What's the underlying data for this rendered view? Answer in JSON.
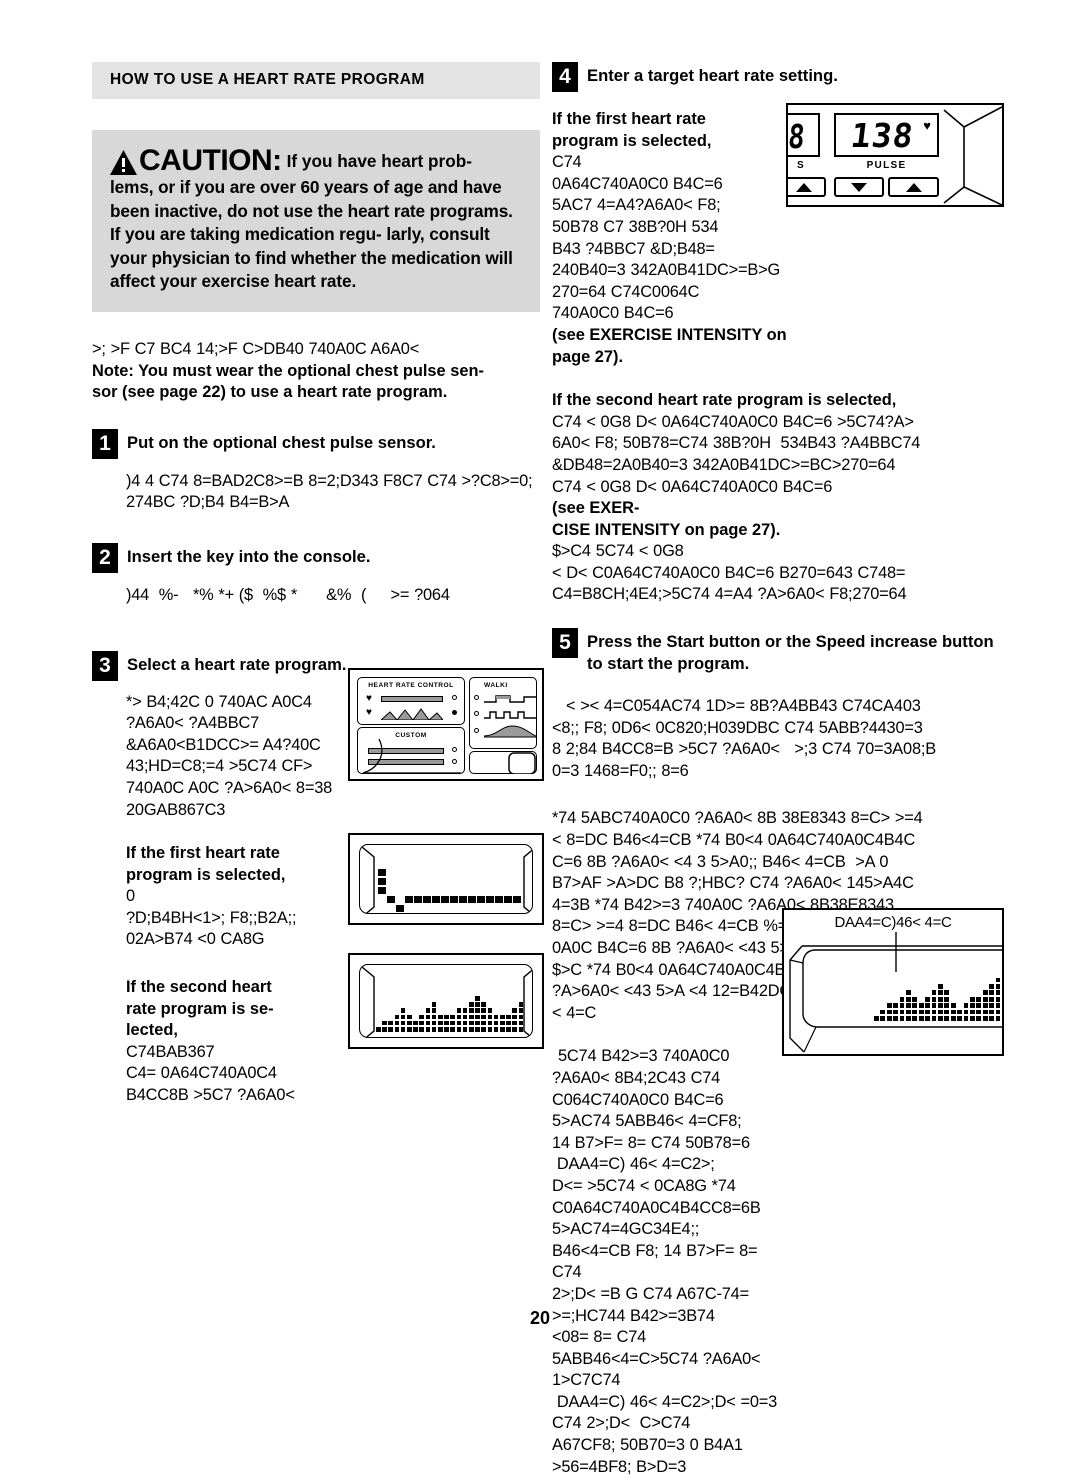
{
  "document": {
    "page_number": "20"
  },
  "left_column": {
    "section_title": "HOW TO USE A HEART RATE PROGRAM",
    "caution": {
      "warning_icon": "warning-triangle-icon",
      "heading": "CAUTION:",
      "lead_in": "If you have heart prob-",
      "body": "lems, or if you are over 60 years of age and\nhave been inactive, do not use the heart rate\nprograms. If you are taking medication regu-\nlarly, consult your physician to find whether the\nmedication will affect your exercise heart rate."
    },
    "intro_garbled": ">; >F C7 BC4 14;>F C>DB40 740A0C A6A0<",
    "intro_note": "Note: You must wear the optional chest pulse sen-\nsor (see page 22) to use a heart rate program.",
    "steps": [
      {
        "number": "1",
        "heading": "Put on the optional chest pulse sensor.",
        "body_garbled": ")4 4 C74 8=BAD2C8>=B 8=2;D343 F8C7 C74 >?C8>=0;\n274BC ?D;B4 B4=B>A"
      },
      {
        "number": "2",
        "heading": "Insert the key into the console.",
        "body_garbled": ")44  %-   *% *+ ($  %$ *      &%  (     >= ?064"
      },
      {
        "number": "3",
        "heading": "Select a heart rate program.",
        "body_garbled": "*> B4;42C 0 740AC A0C4\n?A6A0< ?A4BBC7\n&A6A0<B1DCC>= A4?40C\n43;HD=C8;=4 >5C74 CF>\n740A0C A0C ?A>6A0< 8=38\n20GAB867C3",
        "first_program": {
          "bold": "If the first heart rate\nprogram is selected,",
          "garbled": "0\n?D;B4BH<1>; F8;;B2A;;\n02A>B74 <0 CA8G"
        },
        "second_program": {
          "bold": "If the second heart\nrate program is se-\nlected,",
          "garbled": "C74BAB367\nC4= 0A64C740A0C4\nB4CC8B >5C7 ?A6A0<"
        }
      }
    ],
    "console_panel": {
      "heart_rate_control_label": "HEART RATE CONTROL",
      "custom_label": "CUSTOM",
      "walk_label": "WALKI",
      "heart_icon": "heart-icon"
    }
  },
  "right_column": {
    "steps": [
      {
        "number": "4",
        "heading": "Enter a target heart rate setting.",
        "first_program": {
          "bold": "If the first heart rate\nprogram is selected,",
          "garbled": "C74\n0A64C740A0C0 B4C=6\n5AC7 4=A4?A6A0< F8;\n50B78 C7 38B?0H 534\nB43 ?4BBC7 &D;B48=\n240B40=3 342A0B41DC>=B>G 270=64 C74C0064C\n740A0C0 B4C=6",
          "see_ref": "(see EXERCISE INTENSITY on\npage 27)."
        },
        "second_program": {
          "bold": "If the second heart rate program is selected,",
          "garbled": "C74 < 0G8 D< 0A64C740A0C0 B4C=6 >5C74?A>\n6A0< F8; 50B78=C74 38B?0H  534B43 ?A4BBC74\n&DB48=2A0B40=3 342A0B41DC>=BC>270=64\nC74 < 0G8 D< 0A64C740A0C0 B4C=6",
          "see_ref2": "(see EXER-\nCISE INTENSITY on page 27).",
          "garbled2": "$>C4 5C74 < 0G8\n< D< C0A64C740A0C0 B4C=6 B270=643 C748=\nC4=B8CH;4E4;>5C74 4=A4 ?A>6A0< F8;270=64"
        }
      },
      {
        "number": "5",
        "heading": "Press the Start button or the Speed increase\nbutton to start the program.",
        "body_garbled": "< >< 4=C054AC74 1D>= 8B?A4BB43 C74CA403\n<8;; F8; 0D6< 0C820;H039DBC C74 5ABB?4430=3\n8 2;84 B4CC8=B >5C7 ?A6A0<   >;3 C74 70=3A08;B\n0=3 1468=F0;; 8=6",
        "body_garbled2": "*74 5ABC740A0C0 ?A6A0< 8B 38E8343 8=C> >=4\n< 8=DC B46<4=CB *74 B0<4 0A64C740A0C4B4C\nC=6 8B ?A6A0< <4 3 5>A0;; B46< 4=CB  >A 0\nB7>AF >A>DC B8 ?;HBC? C74 ?A6A0< 145>A4C\n4=3B *74 B42>=3 740A0C ?A6A0< 8B38E8343\n8=C> >=4 8=DC B46< 4=CB %=4 C0A64C740AC\n0A0C B4C=6 8B ?A6A0< <43 5>A027 B46<4=C\n$>C *74 B0<4 0A64C740A0C4B4CC8=60H14\n?A>6A0< <43 5>A <4 12=B42DC8E4B46<4=CB\n< 4=C"
      }
    ],
    "bottom_text": {
      "garbled": "5C74 B42>=3 740A0C0\n?A6A0< 8B4;2C43 C74\nC064C740A0C0 B4C=6\n5>AC74 5ABB46< 4=CF8;\n14 B7>F= 8= C74 50B78=6\n DAA4=C) 46< 4=C2>;\nD<= >5C74 < 0CA8G *74\nC0A64C740A0C4B4CC8=6B\n5>AC74=4GC34E4;; B46<4=CB F8; 14 B7>F= 8= C74\n2>;D< =B G C74 A67C-74=  >=;HC744 B42>=3B74\n<08= 8= C74 5ABB46<4=C>5C74 ?A6A0<   1>C7C74\n DAA4=C) 46< 4=C2>;D< =0=3 C74 2>;D<  C>C74\nA67CF8; 50B70=3 0 B4A1 >56=4BF8; B>D=3",
      "perspective_label": "DAA4=C)46< 4=C"
    }
  }
}
